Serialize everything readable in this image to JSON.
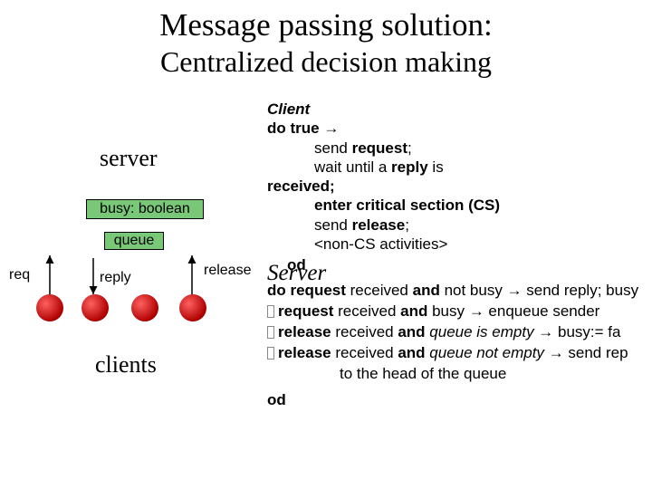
{
  "title1": "Message passing solution:",
  "title2": "Centralized decision making",
  "diagram": {
    "server": "server",
    "busy": "busy: boolean",
    "queue": "queue",
    "req": "req",
    "reply": "reply",
    "release": "release",
    "clients": "clients"
  },
  "client": {
    "header": "Client",
    "l1a": "do true",
    "l1b": " →",
    "l2": "send request;",
    "l3": "wait until a reply is",
    "l4": "received;",
    "l5": "enter critical section (CS)",
    "l6": "send release;",
    "l7": "<non-CS activities>",
    "od": "od"
  },
  "server": {
    "header": "Server",
    "r1": "do request received and not busy → send reply; busy",
    "r2": "request received and busy → enqueue sender",
    "r3": "release received and queue is empty → busy:= fa",
    "r4": "release received and queue not empty → send rep",
    "tail": "to the head of the queue",
    "od": "od"
  }
}
